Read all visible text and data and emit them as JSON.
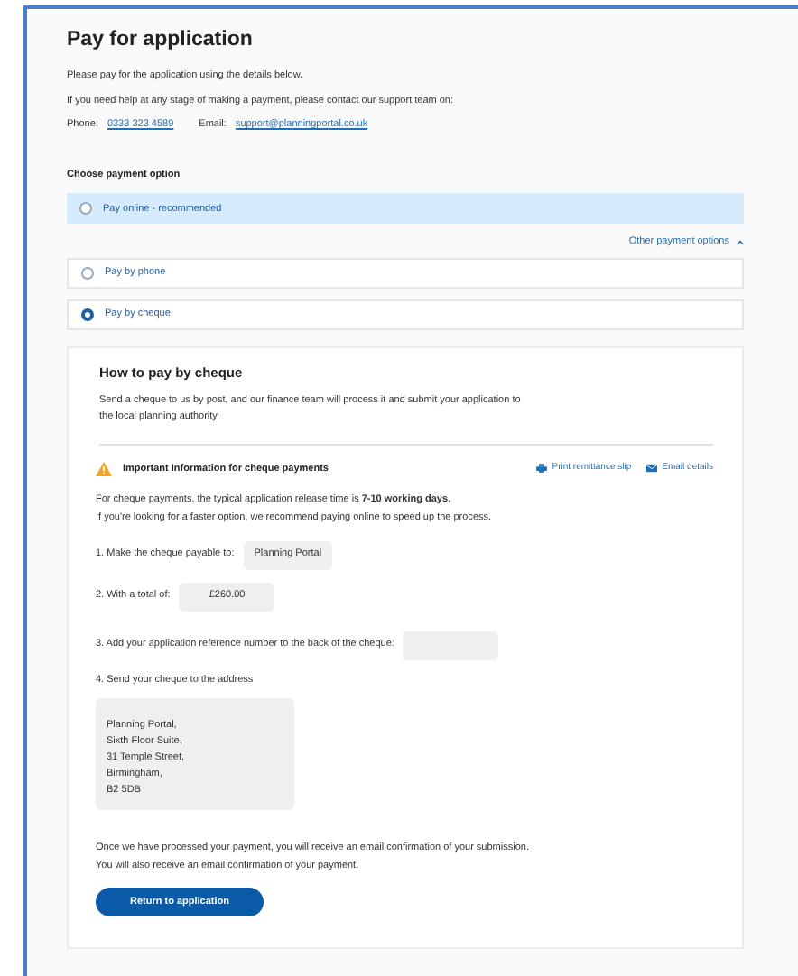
{
  "title": "Pay for application",
  "intro": [
    "Please pay for the application using the details below.",
    "If you need help at any stage of making a payment, please contact our support team on:"
  ],
  "contact": {
    "phone_label": "Phone:",
    "phone": "0333 323 4589",
    "email_label": "Email:",
    "email": "support@planningportal.co.uk"
  },
  "payment_heading": "Choose payment option",
  "primary_option": {
    "label": "Pay online - recommended",
    "selected": false
  },
  "other_options_toggle": {
    "label": "Other payment options",
    "expanded": true
  },
  "other_options": [
    {
      "label": "Pay by phone",
      "selected": false
    },
    {
      "label": "Pay by cheque",
      "selected": true
    }
  ],
  "cheque_panel": {
    "heading": "How to pay by cheque",
    "description": "Send a cheque to us by post, and our finance team will process it and submit your application to the local planning authority.",
    "notice_title": "Important Information for cheque payments",
    "actions": [
      {
        "kind": "print",
        "label": "Print remittance slip"
      },
      {
        "kind": "email",
        "label": "Email details"
      }
    ],
    "info": [
      "For cheque payments, the typical application release time is **7-10 working days**.",
      "If you're looking for a faster option, we recommend paying online to speed up the process."
    ],
    "steps": [
      {
        "label": "1. Make the cheque payable to:",
        "value": "Planning Portal"
      },
      {
        "label": "2. With a total of:",
        "value": "£260.00"
      },
      {
        "label": "3. Add your application reference number to the back of the cheque:"
      },
      {
        "label": "4. Send your cheque to the address",
        "address": [
          "Planning Portal,",
          "Sixth Floor Suite,",
          "31 Temple Street,",
          "Birmingham,",
          "B2 5DB"
        ]
      }
    ],
    "confirmation": [
      "Once we have processed your payment, you will receive an email confirmation of your submission.",
      "You will also receive an email confirmation of your payment."
    ],
    "button": "Return to application"
  }
}
